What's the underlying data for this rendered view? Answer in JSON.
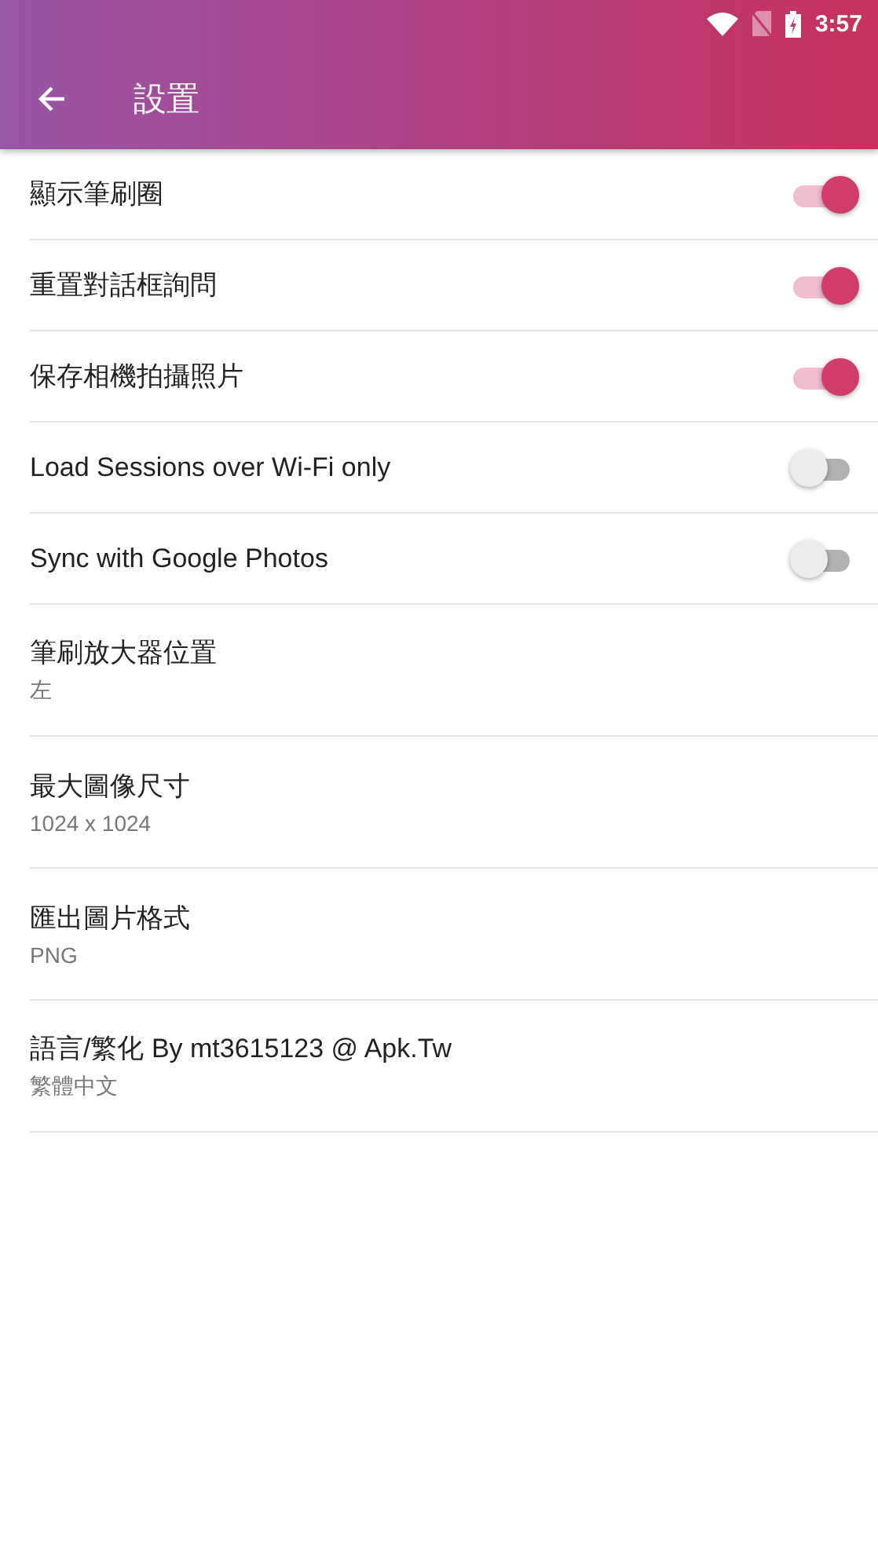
{
  "status_bar": {
    "time": "3:57"
  },
  "app_bar": {
    "title": "設置"
  },
  "settings": [
    {
      "kind": "toggle",
      "title": "顯示筆刷圈",
      "on": true
    },
    {
      "kind": "toggle",
      "title": "重置對話框詢問",
      "on": true
    },
    {
      "kind": "toggle",
      "title": "保存相機拍攝照片",
      "on": true
    },
    {
      "kind": "toggle",
      "title": "Load Sessions over Wi-Fi only",
      "on": false
    },
    {
      "kind": "toggle",
      "title": "Sync with Google Photos",
      "on": false
    },
    {
      "kind": "value",
      "title": "筆刷放大器位置",
      "value": "左"
    },
    {
      "kind": "value",
      "title": "最大圖像尺寸",
      "value": "1024 x 1024"
    },
    {
      "kind": "value",
      "title": "匯出圖片格式",
      "value": "PNG"
    },
    {
      "kind": "value",
      "title": "語言/繁化 By mt3615123 @ Apk.Tw",
      "value": "繁體中文"
    }
  ]
}
